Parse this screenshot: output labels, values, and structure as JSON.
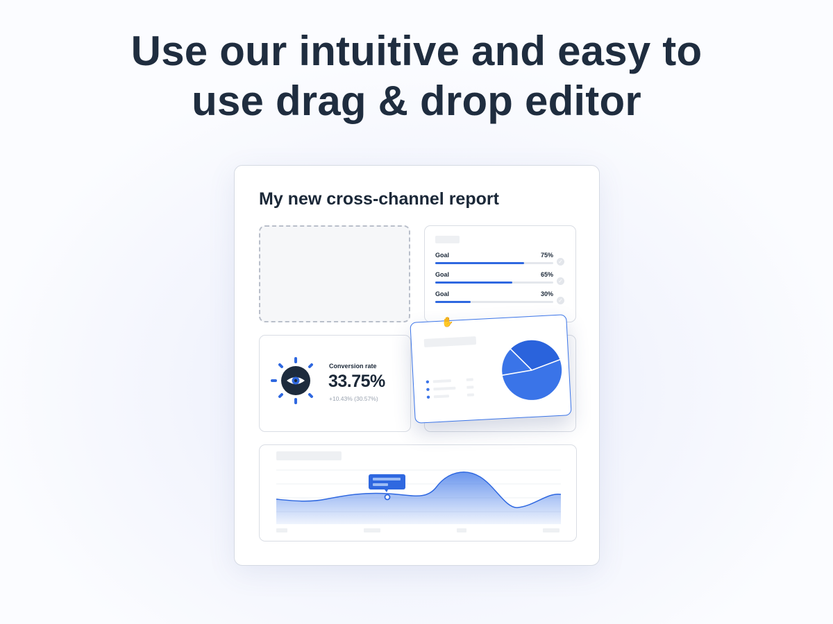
{
  "headline": {
    "line1": "Use our intuitive and easy to",
    "line2": "use drag & drop editor"
  },
  "report": {
    "title": "My new cross-channel report",
    "goals": [
      {
        "label": "Goal",
        "percent_text": "75%",
        "progress": 0.75
      },
      {
        "label": "Goal",
        "percent_text": "65%",
        "progress": 0.65
      },
      {
        "label": "Goal",
        "percent_text": "30%",
        "progress": 0.3
      }
    ],
    "conversion": {
      "label": "Conversion rate",
      "value": "33.75%",
      "change": "+10.43% (30.57%)"
    }
  },
  "colors": {
    "accent": "#2f68e0",
    "pie_main": "#3a74e8",
    "pie_slice": "#2a63dc",
    "text_dark": "#1b2838"
  },
  "icons": {
    "eye": "eye-icon",
    "cursor": "grab-hand-icon",
    "check": "check-icon"
  }
}
